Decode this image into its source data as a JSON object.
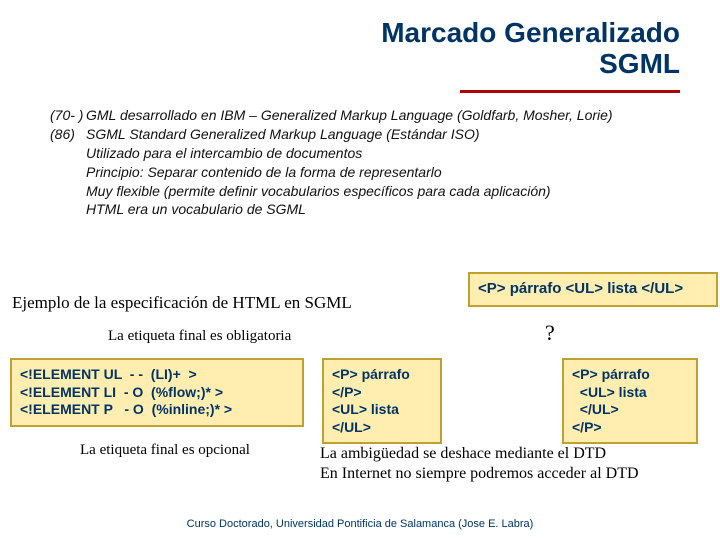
{
  "title": {
    "line1": "Marcado Generalizado",
    "line2": "SGML"
  },
  "bullets": {
    "r1_year": "(70- )",
    "r1_text": "GML desarrollado en IBM – Generalized Markup Language (Goldfarb, Mosher, Lorie)",
    "r2_year": "(86)",
    "r2_text": "SGML Standard Generalized Markup Language (Estándar ISO)",
    "r3": "Utilizado para el intercambio de documentos",
    "r4": "Principio: Separar contenido de la forma de representarlo",
    "r5": "Muy flexible (permite definir vocabularios específicos para cada aplicación)",
    "r6": "HTML era un vocabulario de SGML"
  },
  "example_label": "Ejemplo de la especificación de HTML en SGML",
  "tag_required_label": "La etiqueta final es obligatoria",
  "tag_optional_label": "La etiqueta final es opcional",
  "dtd_code": "<!ELEMENT UL  - -  (LI)+  >\n<!ELEMENT LI  - O  (%flow;)* >\n<!ELEMENT P   - O  (%inline;)* >",
  "example1": "<P> párrafo <UL> lista </UL>",
  "qmark": "?",
  "example2": "<P> párrafo\n</P>\n<UL> lista\n</UL>",
  "example3": "<P> párrafo\n  <UL> lista\n  </UL>\n</P>",
  "ambiguity": {
    "l1": "La ambigüedad se deshace mediante el DTD",
    "l2": "En Internet no siempre podremos acceder al DTD"
  },
  "footer": "Curso Doctorado, Universidad Pontificia de Salamanca (Jose E. Labra)"
}
